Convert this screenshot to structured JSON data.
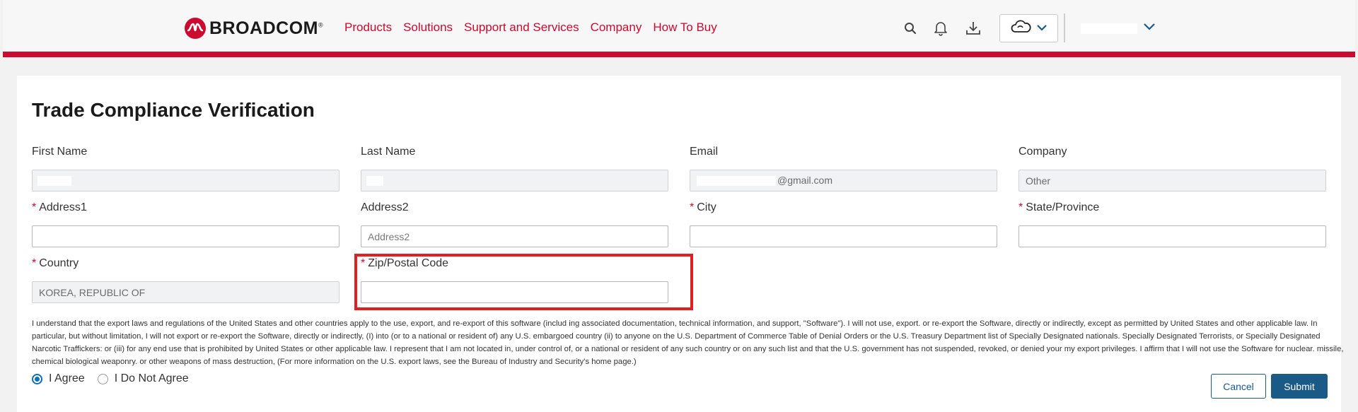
{
  "header": {
    "logo_text": "BROADCOM",
    "logo_mark": "®",
    "nav": [
      "Products",
      "Solutions",
      "Support and Services",
      "Company",
      "How To Buy"
    ],
    "icons": [
      "search-icon",
      "bell-icon",
      "download-icon",
      "cloud-icon",
      "chevron-down-icon"
    ],
    "accent_color": "#cc092f"
  },
  "form": {
    "title": "Trade Compliance Verification",
    "first_name": {
      "label": "First Name",
      "value": ""
    },
    "last_name": {
      "label": "Last Name",
      "value": ""
    },
    "email": {
      "label": "Email",
      "value": "@gmail.com"
    },
    "company": {
      "label": "Company",
      "value": "Other"
    },
    "address1": {
      "label": "Address1",
      "required": "*",
      "value": ""
    },
    "address2": {
      "label": "Address2",
      "placeholder": "Address2"
    },
    "city": {
      "label": "City",
      "required": "*",
      "value": ""
    },
    "state": {
      "label": "State/Province",
      "required": "*",
      "value": ""
    },
    "country": {
      "label": "Country",
      "required": "*",
      "value": "KOREA, REPUBLIC OF"
    },
    "zip": {
      "label": "Zip/Postal Code",
      "required": "*",
      "value": ""
    }
  },
  "legal_text": "I understand that the export laws and regulations of the United States and other countries apply to the use, export, and re-export of this software (includ ing associated documentation, technical information, and support, \"Software\"). I will not use, export. or re-export the Software, directly or indirectly, except as permitted by United States and other applicable law. In particular, but without limitation, I will not export or re-export the Software, directly or indirectly, (I) into (or to a national or resident of) any U.S. embargoed country (ii) to anyone on the U.S. Department of Commerce Table of Denial Orders or the U.S. Treasury Department list of Specially Designated nationals. Specially Designated Terrorists, or Specially Designated Narcotic Traffickers: or (iii) for any end use that is prohibited by United States or other applicable law. I represent that I am not located in, under control of, or a national or resident of any such country or on any such list and that the U.S. government has not suspended, revoked, or denied your my export privileges. I affirm that I will not use the Software for nuclear. missile, chemical biological weaponry. or other weapons of mass destruction, (For more information on the U.S. export laws, see the Bureau of Industry and Security's home page.)",
  "agreement": {
    "agree_label": "I Agree",
    "disagree_label": "I Do Not Agree",
    "selected": "I Agree"
  },
  "buttons": {
    "cancel": "Cancel",
    "submit": "Submit"
  }
}
